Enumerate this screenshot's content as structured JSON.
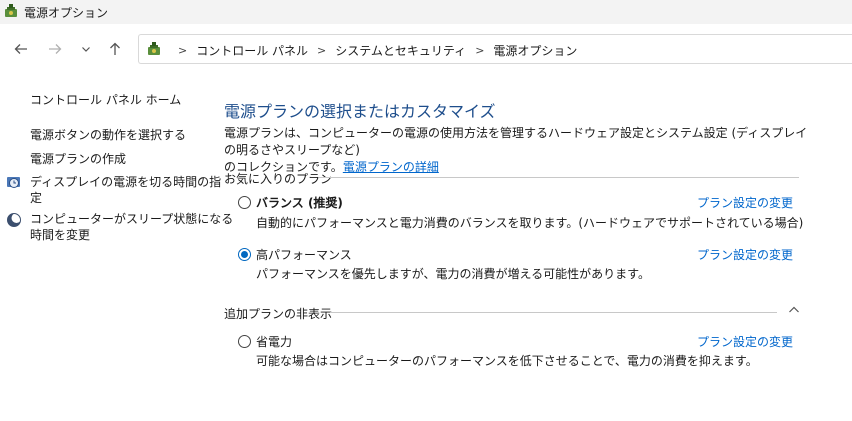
{
  "window": {
    "title": "電源オプション",
    "icon": "power-options-icon"
  },
  "nav": {
    "back": "back-arrow-icon",
    "forward": "forward-arrow-icon",
    "recent": "chevron-down-icon",
    "up": "up-arrow-icon"
  },
  "breadcrumb": [
    "コントロール パネル",
    "システムとセキュリティ",
    "電源オプション"
  ],
  "sidebar": {
    "home": "コントロール パネル ホーム",
    "links": [
      "電源ボタンの動作を選択する",
      "電源プランの作成",
      "ディスプレイの電源を切る時間の指定",
      "コンピューターがスリープ状態になる時間を変更"
    ],
    "display_link_lines": [
      "ディスプレイの電源を切る時間の指",
      "定"
    ],
    "sleep_link_lines": [
      "コンピューターがスリープ状態になる",
      "時間を変更"
    ]
  },
  "main": {
    "title": "電源プランの選択またはカスタマイズ",
    "description_line1": "電源プランは、コンピューターの電源の使用方法を管理するハードウェア設定とシステム設定 (ディスプレイの明るさやスリープなど)",
    "description_line2": "のコレクションです。",
    "details_link": "電源プランの詳細",
    "favorites_label": "お気に入りのプラン",
    "hidden_label": "追加プランの非表示",
    "plans": [
      {
        "name": "バランス (推奨)",
        "description": "自動的にパフォーマンスと電力消費のバランスを取ります。(ハードウェアでサポートされている場合)",
        "selected": false,
        "change_link": "プラン設定の変更"
      },
      {
        "name": "高パフォーマンス",
        "description": "パフォーマンスを優先しますが、電力の消費が増える可能性があります。",
        "selected": true,
        "change_link": "プラン設定の変更"
      },
      {
        "name": "省電力",
        "description": "可能な場合はコンピューターのパフォーマンスを低下させることで、電力の消費を抑えます。",
        "selected": false,
        "change_link": "プラン設定の変更"
      }
    ]
  },
  "colors": {
    "title_blue": "#1e4e8c",
    "link_blue": "#0066cc",
    "radio_blue": "#0067c0"
  }
}
